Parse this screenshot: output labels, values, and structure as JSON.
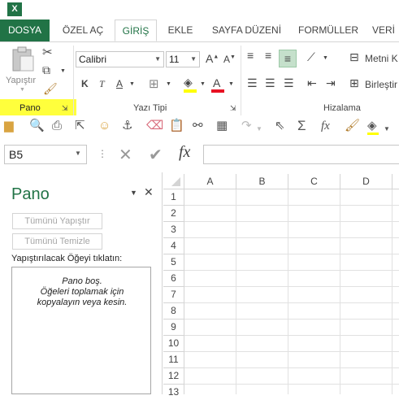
{
  "app": {
    "icon_letter": "X"
  },
  "tabs": [
    {
      "label": "DOSYA"
    },
    {
      "label": "ÖZEL AÇ"
    },
    {
      "label": "GİRİŞ"
    },
    {
      "label": "EKLE"
    },
    {
      "label": "SAYFA DÜZENİ"
    },
    {
      "label": "FORMÜLLER"
    },
    {
      "label": "VERİ"
    }
  ],
  "ribbon": {
    "clipboard": {
      "paste_label": "Yapıştır",
      "group_label": "Pano"
    },
    "font": {
      "font_name": "Calibri",
      "font_size": "11",
      "group_label": "Yazı Tipi",
      "bold": "K",
      "italic": "T",
      "underline": "A"
    },
    "alignment": {
      "group_label": "Hizalama",
      "wrap_label": "Metni K",
      "merge_label": "Birleştir"
    }
  },
  "formula_bar": {
    "name_box": "B5",
    "fx": "fx",
    "value": ""
  },
  "clipboard_pane": {
    "title": "Pano",
    "paste_all": "Tümünü Yapıştır",
    "clear_all": "Tümünü Temizle",
    "prompt": "Yapıştırılacak Öğeyi tıklatın:",
    "empty_lines": [
      "Pano boş.",
      "Öğeleri toplamak için",
      "kopyalayın veya kesin."
    ]
  },
  "grid": {
    "columns": [
      "A",
      "B",
      "C",
      "D"
    ],
    "rows": [
      "1",
      "2",
      "3",
      "4",
      "5",
      "6",
      "7",
      "8",
      "9",
      "10",
      "11",
      "12",
      "13"
    ]
  },
  "colors": {
    "accent": "#217346",
    "highlight": "#ffff3c"
  }
}
